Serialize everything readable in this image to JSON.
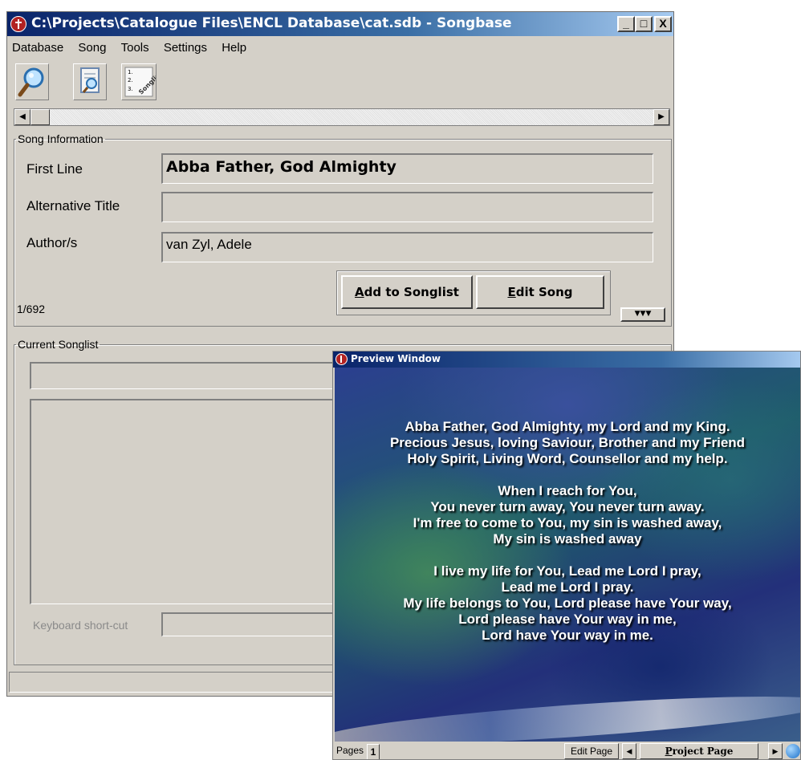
{
  "main_window": {
    "title": "C:\\Projects\\Catalogue Files\\ENCL Database\\cat.sdb - Songbase",
    "caption_buttons": {
      "minimize": "_",
      "maximize": "□",
      "close": "X"
    },
    "menu": [
      "Database",
      "Song",
      "Tools",
      "Settings",
      "Help"
    ],
    "toolbar": [
      {
        "icon": "magnifier-icon"
      },
      {
        "icon": "document-search-icon"
      },
      {
        "icon": "songlist-icon",
        "text": "1.\n2.\n3.Songlist"
      }
    ],
    "song_information": {
      "legend": "Song Information",
      "first_line_label": "First Line",
      "first_line_value": "Abba Father, God Almighty",
      "alt_title_label": "Alternative Title",
      "alt_title_value": "",
      "authors_label": "Author/s",
      "authors_value": "van Zyl, Adele",
      "counter": "1/692",
      "add_button": {
        "accel": "A",
        "rest": "dd to Songlist"
      },
      "edit_button": {
        "accel": "E",
        "rest": "dit Song"
      }
    },
    "current_songlist": {
      "legend": "Current Songlist",
      "shortcut_label": "Keyboard short-cut"
    }
  },
  "preview_window": {
    "title": "Preview Window",
    "lyrics": "Abba Father, God Almighty, my Lord and my King.\nPrecious Jesus, loving Saviour, Brother and my Friend\nHoly Spirit, Living Word, Counsellor and my help.\n\nWhen I reach for You,\nYou never turn away, You never turn away.\nI'm free to come to You, my sin is washed away,\nMy sin is washed away\n\nI live my life for You, Lead me Lord I pray,\nLead me Lord I pray.\nMy life belongs to You, Lord please have Your way,\nLord please have Your way in me,\nLord have Your way in me.",
    "pages_label": "Pages",
    "page_number": "1",
    "edit_page": "Edit Page",
    "project_page": {
      "accel": "P",
      "rest": "roject Page"
    }
  }
}
